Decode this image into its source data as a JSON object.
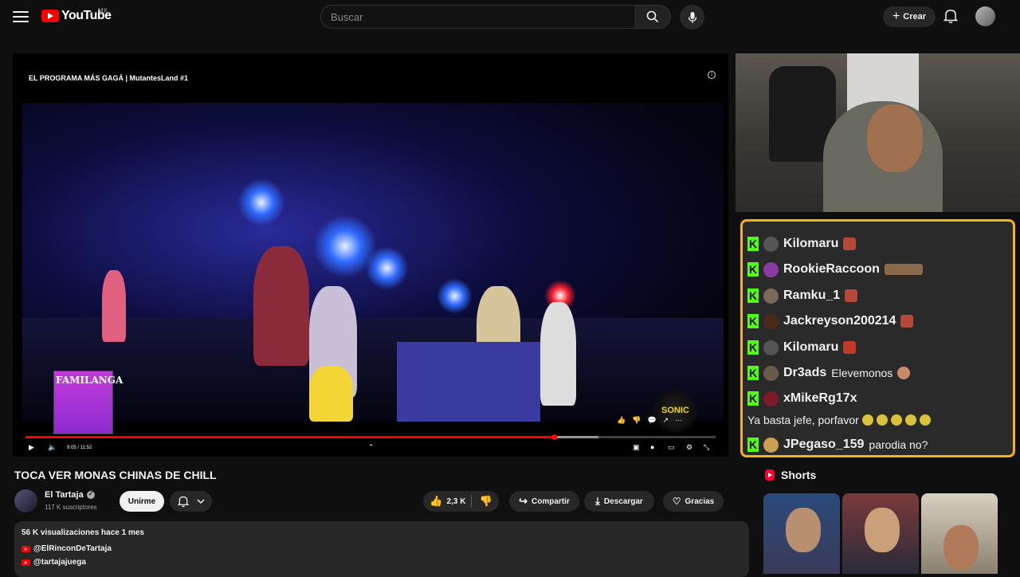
{
  "header": {
    "logo_text": "YouTube",
    "country_code": "MX",
    "search_placeholder": "Buscar",
    "create_label": "Crear"
  },
  "player": {
    "overlay_title": "EL PROGRAMA MÁS GAGÁ | MutantesLand #1",
    "time_display": "9:05 / 11:52",
    "progress_fraction": 0.7654,
    "buffer_fraction": 0.83,
    "cover_text": "FAMILANGA",
    "badge_text": "SONIC"
  },
  "video": {
    "title": "TOCA VER MONAS CHINAS DE CHILL",
    "channel_name": "El Tartaja",
    "subscribers": "117 K suscriptores",
    "join_label": "Unirme",
    "likes": "2,3 K",
    "share_label": "Compartir",
    "download_label": "Descargar",
    "thanks_label": "Gracias"
  },
  "description": {
    "meta": "56 K visualizaciones  hace 1 mes",
    "links": [
      "@ElRinconDeTartaja",
      "@tartajajuega"
    ]
  },
  "chat": {
    "rows": [
      {
        "user": "Kilomaru",
        "message": "",
        "emote": "square"
      },
      {
        "user": "RookieRaccoon",
        "message": "",
        "emote": "wide"
      },
      {
        "user": "Ramku_1",
        "message": "",
        "emote": "square"
      },
      {
        "user": "Jackreyson200214",
        "message": "",
        "emote": "square"
      },
      {
        "user": "Kilomaru",
        "message": "",
        "emote": "square"
      },
      {
        "user": "Dr3ads",
        "message": "Elevemonos",
        "emote": "square"
      },
      {
        "user": "xMikeRg17x",
        "message": "",
        "emote": "none"
      }
    ],
    "plain_message": "Ya basta jefe, porfavor",
    "last_row": {
      "user": "JPegaso_159",
      "message": "parodia no?"
    },
    "border_color": "#f5b21c",
    "badge_color": "#53fc18"
  },
  "shorts": {
    "title": "Shorts"
  },
  "colors": {
    "accent": "#ff0000",
    "background": "#0f0f0f"
  }
}
